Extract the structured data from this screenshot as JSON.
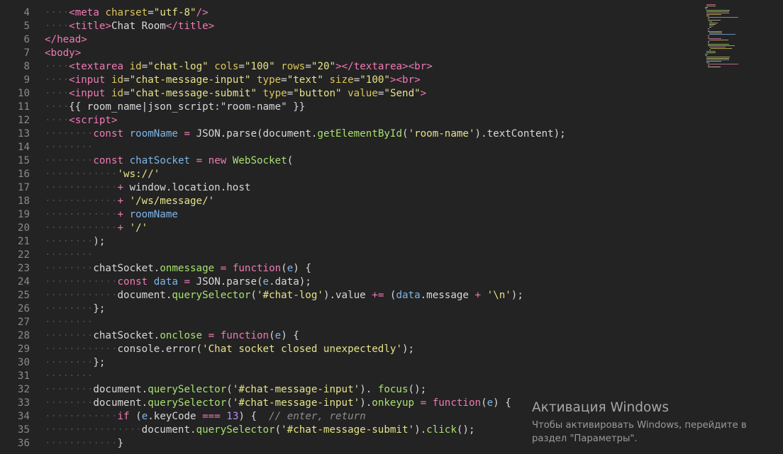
{
  "editor": {
    "lines": [
      {
        "n": "4",
        "tokens": [
          [
            "ws",
            "····"
          ],
          [
            "tag",
            "<meta"
          ],
          [
            "plain",
            " "
          ],
          [
            "attr",
            "charset"
          ],
          [
            "plain",
            "="
          ],
          [
            "str",
            "\"utf-8\""
          ],
          [
            "tag",
            "/>"
          ]
        ]
      },
      {
        "n": "5",
        "tokens": [
          [
            "ws",
            "····"
          ],
          [
            "tag",
            "<title>"
          ],
          [
            "plain",
            "Chat Room"
          ],
          [
            "tag",
            "</title>"
          ]
        ]
      },
      {
        "n": "6",
        "tokens": [
          [
            "tag",
            "</head>"
          ]
        ]
      },
      {
        "n": "7",
        "tokens": [
          [
            "tag",
            "<body>"
          ]
        ]
      },
      {
        "n": "8",
        "tokens": [
          [
            "ws",
            "····"
          ],
          [
            "tag",
            "<textarea"
          ],
          [
            "plain",
            " "
          ],
          [
            "attr",
            "id"
          ],
          [
            "plain",
            "="
          ],
          [
            "str",
            "\"chat-log\""
          ],
          [
            "plain",
            " "
          ],
          [
            "attr",
            "cols"
          ],
          [
            "plain",
            "="
          ],
          [
            "str",
            "\"100\""
          ],
          [
            "plain",
            " "
          ],
          [
            "attr",
            "rows"
          ],
          [
            "plain",
            "="
          ],
          [
            "str",
            "\"20\""
          ],
          [
            "tag",
            "></textarea><br>"
          ]
        ]
      },
      {
        "n": "9",
        "tokens": [
          [
            "ws",
            "····"
          ],
          [
            "tag",
            "<input"
          ],
          [
            "plain",
            " "
          ],
          [
            "attr",
            "id"
          ],
          [
            "plain",
            "="
          ],
          [
            "str",
            "\"chat-message-input\""
          ],
          [
            "plain",
            " "
          ],
          [
            "attr",
            "type"
          ],
          [
            "plain",
            "="
          ],
          [
            "str",
            "\"text\""
          ],
          [
            "plain",
            " "
          ],
          [
            "attr",
            "size"
          ],
          [
            "plain",
            "="
          ],
          [
            "str",
            "\"100\""
          ],
          [
            "tag",
            "><br>"
          ]
        ]
      },
      {
        "n": "10",
        "tokens": [
          [
            "ws",
            "····"
          ],
          [
            "tag",
            "<input"
          ],
          [
            "plain",
            " "
          ],
          [
            "attr",
            "id"
          ],
          [
            "plain",
            "="
          ],
          [
            "str",
            "\"chat-message-submit\""
          ],
          [
            "plain",
            " "
          ],
          [
            "attr",
            "type"
          ],
          [
            "plain",
            "="
          ],
          [
            "str",
            "\"button\""
          ],
          [
            "plain",
            " "
          ],
          [
            "attr",
            "value"
          ],
          [
            "plain",
            "="
          ],
          [
            "str",
            "\"Send\""
          ],
          [
            "tag",
            ">"
          ]
        ]
      },
      {
        "n": "11",
        "tokens": [
          [
            "ws",
            "····"
          ],
          [
            "plain",
            "{{ room_name|json_script:\"room-name\" }}"
          ]
        ]
      },
      {
        "n": "12",
        "tokens": [
          [
            "ws",
            "····"
          ],
          [
            "tag",
            "<script>"
          ]
        ]
      },
      {
        "n": "13",
        "tokens": [
          [
            "ws",
            "········"
          ],
          [
            "kw",
            "const"
          ],
          [
            "plain",
            " "
          ],
          [
            "var",
            "roomName"
          ],
          [
            "plain",
            " "
          ],
          [
            "op",
            "="
          ],
          [
            "plain",
            " JSON.parse(document."
          ],
          [
            "fn",
            "getElementById"
          ],
          [
            "plain",
            "("
          ],
          [
            "str",
            "'room-name'"
          ],
          [
            "plain",
            ").textContent);"
          ]
        ]
      },
      {
        "n": "14",
        "tokens": [
          [
            "ws",
            "········"
          ]
        ]
      },
      {
        "n": "15",
        "tokens": [
          [
            "ws",
            "········"
          ],
          [
            "kw",
            "const"
          ],
          [
            "plain",
            " "
          ],
          [
            "var",
            "chatSocket"
          ],
          [
            "plain",
            " "
          ],
          [
            "op",
            "="
          ],
          [
            "plain",
            " "
          ],
          [
            "kw",
            "new"
          ],
          [
            "plain",
            " "
          ],
          [
            "fn",
            "WebSocket"
          ],
          [
            "plain",
            "("
          ]
        ]
      },
      {
        "n": "16",
        "tokens": [
          [
            "ws",
            "············"
          ],
          [
            "str",
            "'ws://'"
          ]
        ]
      },
      {
        "n": "17",
        "tokens": [
          [
            "ws",
            "············"
          ],
          [
            "op",
            "+"
          ],
          [
            "plain",
            " window.location.host"
          ]
        ]
      },
      {
        "n": "18",
        "tokens": [
          [
            "ws",
            "············"
          ],
          [
            "op",
            "+"
          ],
          [
            "plain",
            " "
          ],
          [
            "str",
            "'/ws/message/'"
          ]
        ]
      },
      {
        "n": "19",
        "tokens": [
          [
            "ws",
            "············"
          ],
          [
            "op",
            "+"
          ],
          [
            "plain",
            " "
          ],
          [
            "var",
            "roomName"
          ]
        ]
      },
      {
        "n": "20",
        "tokens": [
          [
            "ws",
            "············"
          ],
          [
            "op",
            "+"
          ],
          [
            "plain",
            " "
          ],
          [
            "str",
            "'/'"
          ]
        ]
      },
      {
        "n": "21",
        "tokens": [
          [
            "ws",
            "········"
          ],
          [
            "plain",
            ");"
          ]
        ]
      },
      {
        "n": "22",
        "tokens": [
          [
            "ws",
            "········"
          ]
        ]
      },
      {
        "n": "23",
        "tokens": [
          [
            "ws",
            "········"
          ],
          [
            "plain",
            "chatSocket."
          ],
          [
            "fn",
            "onmessage"
          ],
          [
            "plain",
            " "
          ],
          [
            "op",
            "="
          ],
          [
            "plain",
            " "
          ],
          [
            "kw",
            "function"
          ],
          [
            "plain",
            "("
          ],
          [
            "var",
            "e"
          ],
          [
            "plain",
            ") {"
          ]
        ]
      },
      {
        "n": "24",
        "tokens": [
          [
            "ws",
            "············"
          ],
          [
            "kw",
            "const"
          ],
          [
            "plain",
            " "
          ],
          [
            "var",
            "data"
          ],
          [
            "plain",
            " "
          ],
          [
            "op",
            "="
          ],
          [
            "plain",
            " JSON.parse("
          ],
          [
            "var",
            "e"
          ],
          [
            "plain",
            ".data);"
          ]
        ]
      },
      {
        "n": "25",
        "tokens": [
          [
            "ws",
            "············"
          ],
          [
            "plain",
            "document."
          ],
          [
            "fn",
            "querySelector"
          ],
          [
            "plain",
            "("
          ],
          [
            "str",
            "'#chat-log'"
          ],
          [
            "plain",
            ").value "
          ],
          [
            "op",
            "+="
          ],
          [
            "plain",
            " ("
          ],
          [
            "var",
            "data"
          ],
          [
            "plain",
            ".message "
          ],
          [
            "op",
            "+"
          ],
          [
            "plain",
            " "
          ],
          [
            "str",
            "'\\n'"
          ],
          [
            "plain",
            ");"
          ]
        ]
      },
      {
        "n": "26",
        "tokens": [
          [
            "ws",
            "········"
          ],
          [
            "plain",
            "};"
          ]
        ]
      },
      {
        "n": "27",
        "tokens": [
          [
            "ws",
            "········"
          ]
        ]
      },
      {
        "n": "28",
        "tokens": [
          [
            "ws",
            "········"
          ],
          [
            "plain",
            "chatSocket."
          ],
          [
            "fn",
            "onclose"
          ],
          [
            "plain",
            " "
          ],
          [
            "op",
            "="
          ],
          [
            "plain",
            " "
          ],
          [
            "kw",
            "function"
          ],
          [
            "plain",
            "("
          ],
          [
            "var",
            "e"
          ],
          [
            "plain",
            ") {"
          ]
        ]
      },
      {
        "n": "29",
        "tokens": [
          [
            "ws",
            "············"
          ],
          [
            "plain",
            "console.error("
          ],
          [
            "str",
            "'Chat socket closed unexpectedly'"
          ],
          [
            "plain",
            ");"
          ]
        ]
      },
      {
        "n": "30",
        "tokens": [
          [
            "ws",
            "········"
          ],
          [
            "plain",
            "};"
          ]
        ]
      },
      {
        "n": "31",
        "tokens": [
          [
            "ws",
            "········"
          ]
        ]
      },
      {
        "n": "32",
        "tokens": [
          [
            "ws",
            "········"
          ],
          [
            "plain",
            "document."
          ],
          [
            "fn",
            "querySelector"
          ],
          [
            "plain",
            "("
          ],
          [
            "str",
            "'#chat-message-input'"
          ],
          [
            "plain",
            "). "
          ],
          [
            "fn",
            "focus"
          ],
          [
            "plain",
            "();"
          ]
        ]
      },
      {
        "n": "33",
        "tokens": [
          [
            "ws",
            "········"
          ],
          [
            "plain",
            "document."
          ],
          [
            "fn",
            "querySelector"
          ],
          [
            "plain",
            "("
          ],
          [
            "str",
            "'#chat-message-input'"
          ],
          [
            "plain",
            ")."
          ],
          [
            "fn",
            "onkeyup"
          ],
          [
            "plain",
            " "
          ],
          [
            "op",
            "="
          ],
          [
            "plain",
            " "
          ],
          [
            "kw",
            "function"
          ],
          [
            "plain",
            "("
          ],
          [
            "var",
            "e"
          ],
          [
            "plain",
            ") {"
          ]
        ]
      },
      {
        "n": "34",
        "tokens": [
          [
            "ws",
            "············"
          ],
          [
            "kw",
            "if"
          ],
          [
            "plain",
            " ("
          ],
          [
            "var",
            "e"
          ],
          [
            "plain",
            ".keyCode "
          ],
          [
            "op",
            "==="
          ],
          [
            "plain",
            " "
          ],
          [
            "num",
            "13"
          ],
          [
            "plain",
            ") {  "
          ],
          [
            "cmt",
            "// enter, return"
          ]
        ]
      },
      {
        "n": "35",
        "tokens": [
          [
            "ws",
            "················"
          ],
          [
            "plain",
            "document."
          ],
          [
            "fn",
            "querySelector"
          ],
          [
            "plain",
            "("
          ],
          [
            "str",
            "'#chat-message-submit'"
          ],
          [
            "plain",
            ")."
          ],
          [
            "fn",
            "click"
          ],
          [
            "plain",
            "();"
          ]
        ]
      },
      {
        "n": "36",
        "tokens": [
          [
            "ws",
            "············"
          ],
          [
            "plain",
            "}"
          ]
        ]
      }
    ]
  },
  "overlay": {
    "title": "Активация Windows",
    "line1": "Чтобы активировать Windows, перейдите в",
    "line2": "раздел \"Параметры\"."
  },
  "colors": {
    "background": "#232323",
    "tag": "#f07ab4",
    "attr": "#dcc65a",
    "string": "#e6e38a",
    "function": "#a8e070",
    "variable": "#7fb6e8",
    "number": "#b58cf0"
  }
}
